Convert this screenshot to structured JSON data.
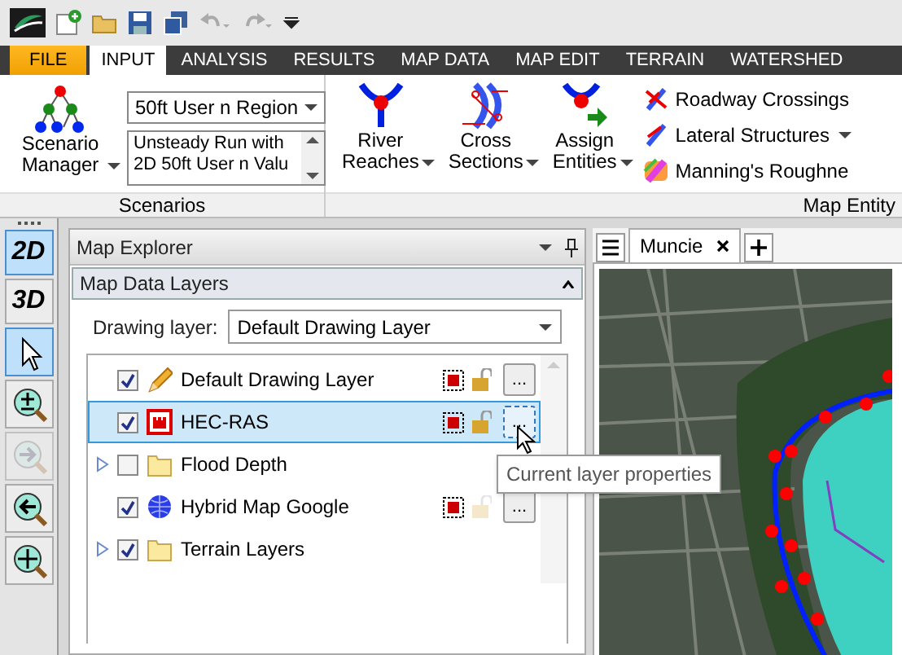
{
  "ribbon_tabs": [
    {
      "label": "FILE",
      "kind": "file",
      "selected": false
    },
    {
      "label": "INPUT",
      "kind": "tab",
      "selected": true
    },
    {
      "label": "ANALYSIS",
      "kind": "tab",
      "selected": false
    },
    {
      "label": "RESULTS",
      "kind": "tab",
      "selected": false
    },
    {
      "label": "MAP DATA",
      "kind": "tab",
      "selected": false
    },
    {
      "label": "MAP EDIT",
      "kind": "tab",
      "selected": false
    },
    {
      "label": "TERRAIN",
      "kind": "tab",
      "selected": false
    },
    {
      "label": "WATERSHED",
      "kind": "tab",
      "selected": false
    }
  ],
  "scenarios": {
    "manager_button": [
      "Scenario",
      "Manager"
    ],
    "scenario_select": "50ft User n Region",
    "description": [
      "Unsteady Run with",
      "2D 50ft User n Valu"
    ],
    "group_label": "Scenarios"
  },
  "map_entity": {
    "large_buttons": [
      {
        "label": [
          "River",
          "Reaches"
        ],
        "kind": "reach"
      },
      {
        "label": [
          "Cross",
          "Sections"
        ],
        "kind": "xs"
      },
      {
        "label": [
          "Assign",
          "Entities"
        ],
        "kind": "assign"
      }
    ],
    "small_buttons": [
      {
        "label": "Roadway Crossings",
        "kind": "road",
        "dropdown": false
      },
      {
        "label": "Lateral Structures",
        "kind": "lateral",
        "dropdown": true
      },
      {
        "label": "Manning's Roughne",
        "kind": "manning",
        "dropdown": false
      }
    ],
    "group_label": "Map Entity"
  },
  "view_toggles": [
    {
      "label": "2D",
      "selected": true
    },
    {
      "label": "3D",
      "selected": false
    }
  ],
  "tools": [
    {
      "kind": "pointer",
      "selected": true,
      "disabled": false
    },
    {
      "kind": "zoom-extent",
      "selected": false,
      "disabled": false
    },
    {
      "kind": "zoom-next",
      "selected": false,
      "disabled": true
    },
    {
      "kind": "zoom-previous",
      "selected": false,
      "disabled": false
    },
    {
      "kind": "pan",
      "selected": false,
      "disabled": false
    }
  ],
  "explorer": {
    "title": "Map Explorer",
    "section": "Map Data Layers",
    "drawing_layer_label": "Drawing layer:",
    "drawing_layer_value": "Default Drawing Layer",
    "layers": [
      {
        "name": "Default Drawing Layer",
        "kind": "pencil",
        "checked": true,
        "expandable": false,
        "selected": false,
        "lock_enabled": true,
        "properties": "..."
      },
      {
        "name": "HEC-RAS",
        "kind": "hecras",
        "checked": true,
        "expandable": false,
        "selected": true,
        "lock_enabled": true,
        "properties": "..."
      },
      {
        "name": "Flood Depth",
        "kind": "folder",
        "checked": false,
        "expandable": true,
        "selected": false
      },
      {
        "name": "Hybrid Map Google",
        "kind": "globe",
        "checked": true,
        "expandable": false,
        "selected": false,
        "lock_enabled": false,
        "properties": "..."
      },
      {
        "name": "Terrain Layers",
        "kind": "folder",
        "checked": true,
        "expandable": true,
        "selected": false
      }
    ],
    "tooltip": "Current layer properties"
  },
  "map_tabs": [
    {
      "label": "Muncie",
      "selected": true
    }
  ]
}
